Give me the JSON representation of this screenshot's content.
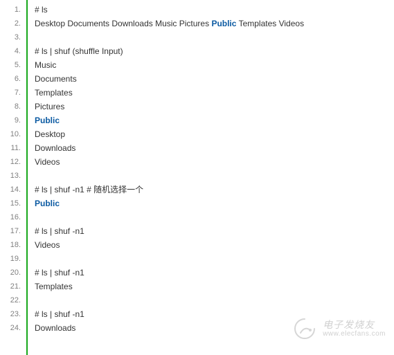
{
  "lines": [
    [
      {
        "t": "# ls"
      }
    ],
    [
      {
        "t": "Desktop  Documents  Downloads  Music  Pictures  "
      },
      {
        "t": "Public",
        "c": "pub"
      },
      {
        "t": "  Templates  Videos"
      }
    ],
    [],
    [
      {
        "t": "#  ls | shuf (shuffle Input)"
      }
    ],
    [
      {
        "t": "Music"
      }
    ],
    [
      {
        "t": "Documents"
      }
    ],
    [
      {
        "t": "Templates"
      }
    ],
    [
      {
        "t": "Pictures"
      }
    ],
    [
      {
        "t": "Public",
        "c": "pub"
      }
    ],
    [
      {
        "t": "Desktop"
      }
    ],
    [
      {
        "t": "Downloads"
      }
    ],
    [
      {
        "t": "Videos"
      }
    ],
    [],
    [
      {
        "t": "#  ls | shuf -n1 # 随机选择一个"
      }
    ],
    [
      {
        "t": "Public",
        "c": "pub"
      }
    ],
    [],
    [
      {
        "t": "# ls | shuf -n1"
      }
    ],
    [
      {
        "t": "Videos"
      }
    ],
    [],
    [
      {
        "t": "# ls | shuf -n1"
      }
    ],
    [
      {
        "t": "Templates"
      }
    ],
    [],
    [
      {
        "t": "# ls | shuf -n1"
      }
    ],
    [
      {
        "t": "Downloads"
      }
    ]
  ],
  "watermark": {
    "top": "电子发烧友",
    "bottom": "www.elecfans.com"
  }
}
